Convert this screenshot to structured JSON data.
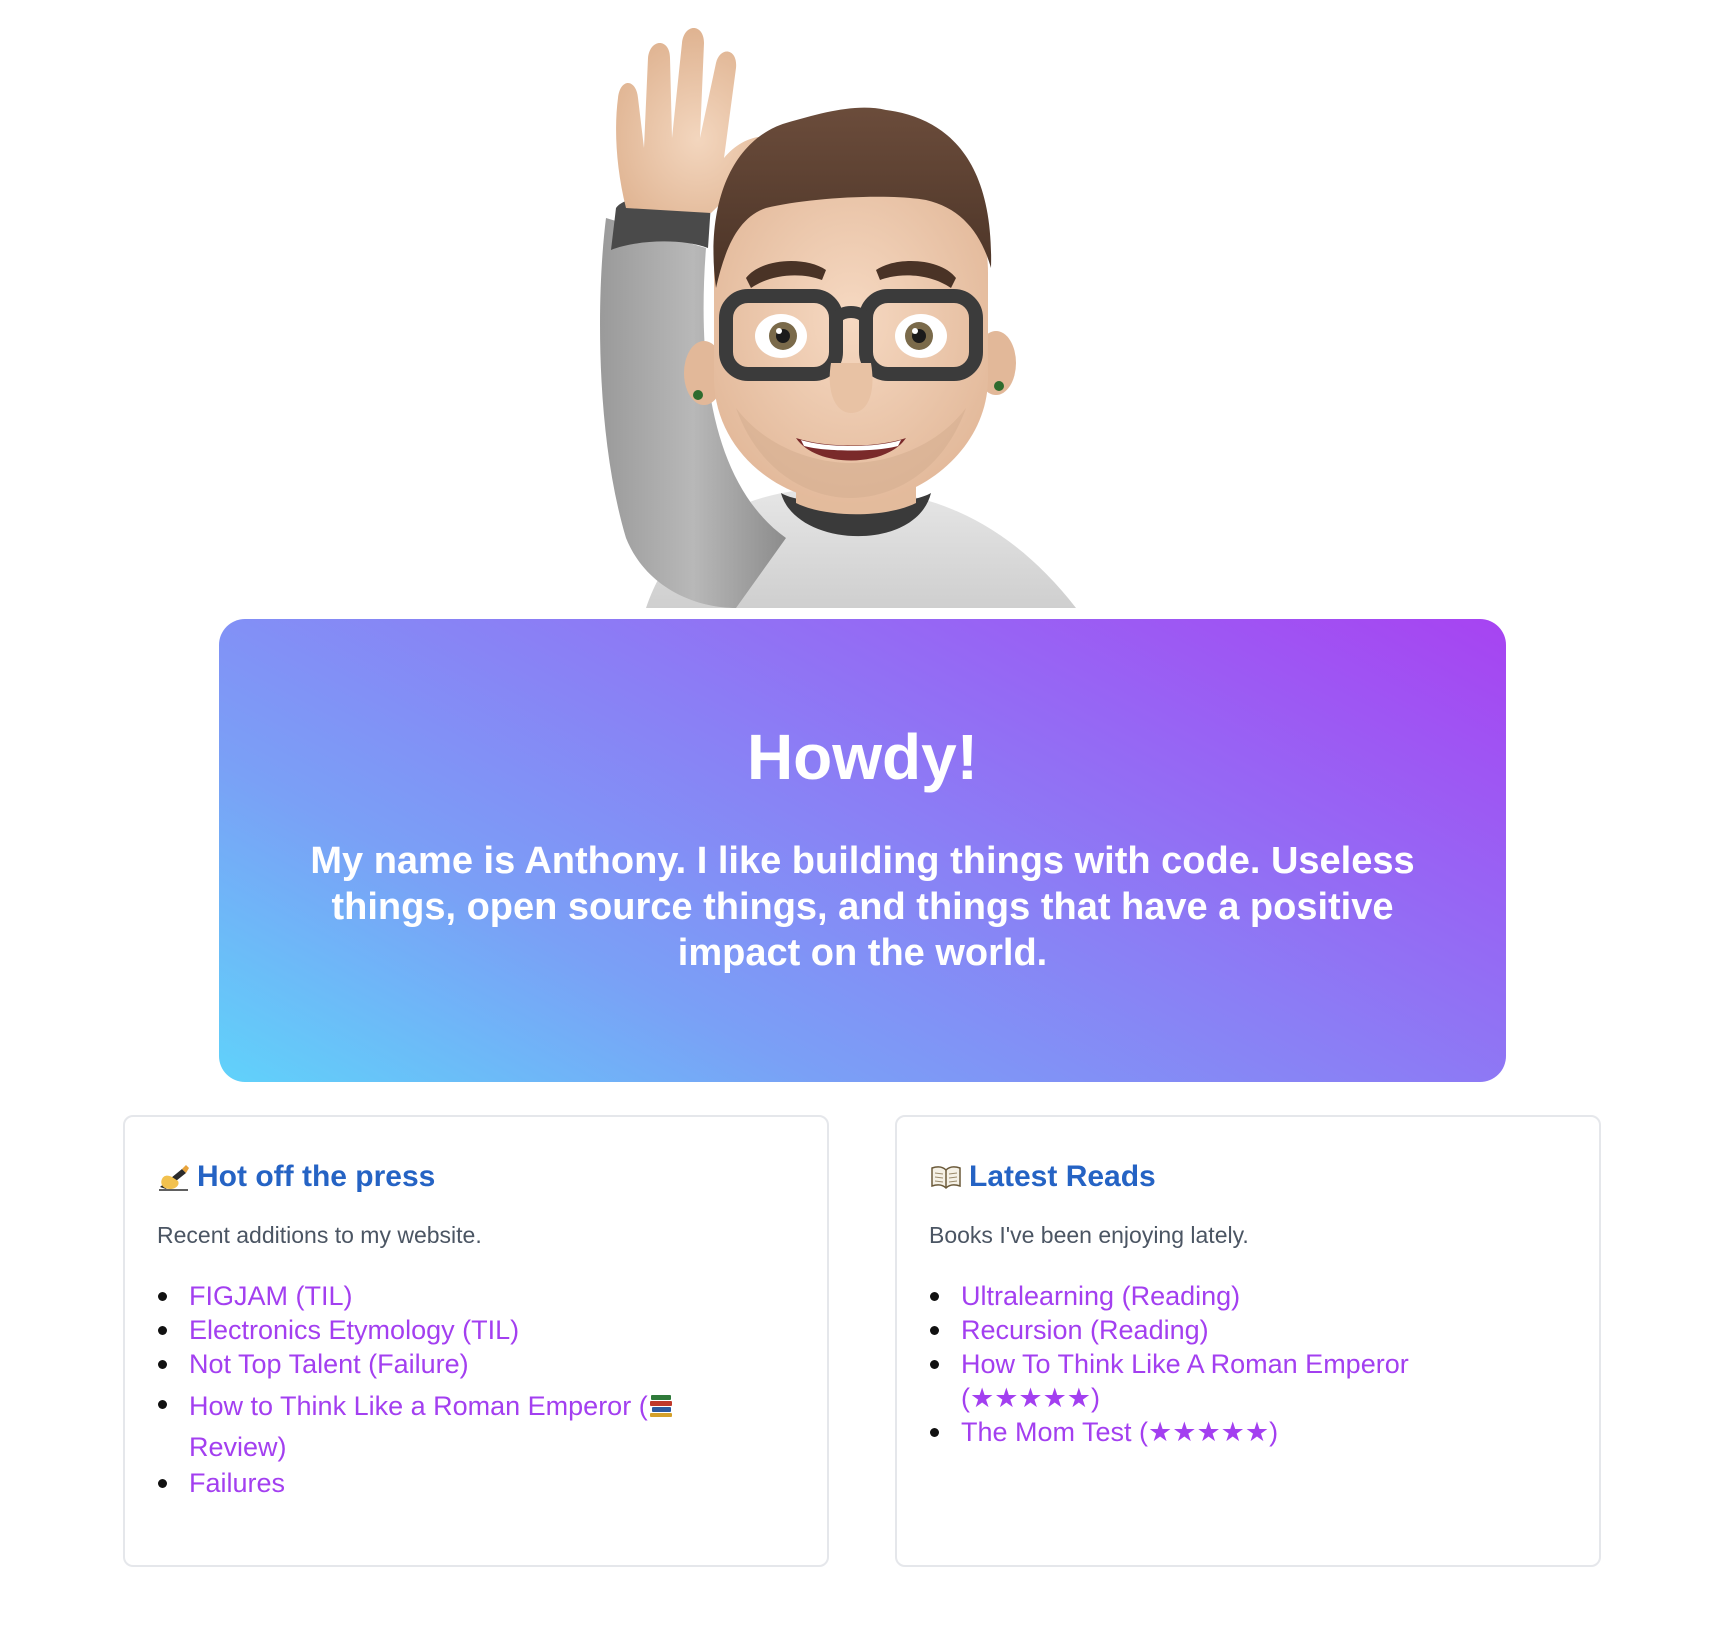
{
  "hero": {
    "title": "Howdy!",
    "text": "My name is Anthony. I like building things with code. Useless things, open source things, and things that have a positive impact on the world."
  },
  "hot": {
    "icon": "writing-hand-icon",
    "heading": "Hot off the press",
    "description": "Recent additions to my website.",
    "items": [
      "FIGJAM (TIL)",
      "Electronics Etymology (TIL)",
      "Not Top Talent (Failure)",
      "How to Think Like a Roman Emperor (",
      "Review)",
      "Failures"
    ],
    "item4_icon": "books-icon"
  },
  "reads": {
    "icon": "open-book-icon",
    "heading": "Latest Reads",
    "description": "Books I've been enjoying lately.",
    "items": [
      "Ultralearning (Reading)",
      "Recursion (Reading)",
      "How To Think Like A Roman Emperor (★★★★★)",
      "The Mom Test (★★★★★)"
    ]
  },
  "colors": {
    "heading": "#2563c4",
    "link": "#a33ff0",
    "gradient_start": "#60d2fa",
    "gradient_end": "#a743f2"
  }
}
